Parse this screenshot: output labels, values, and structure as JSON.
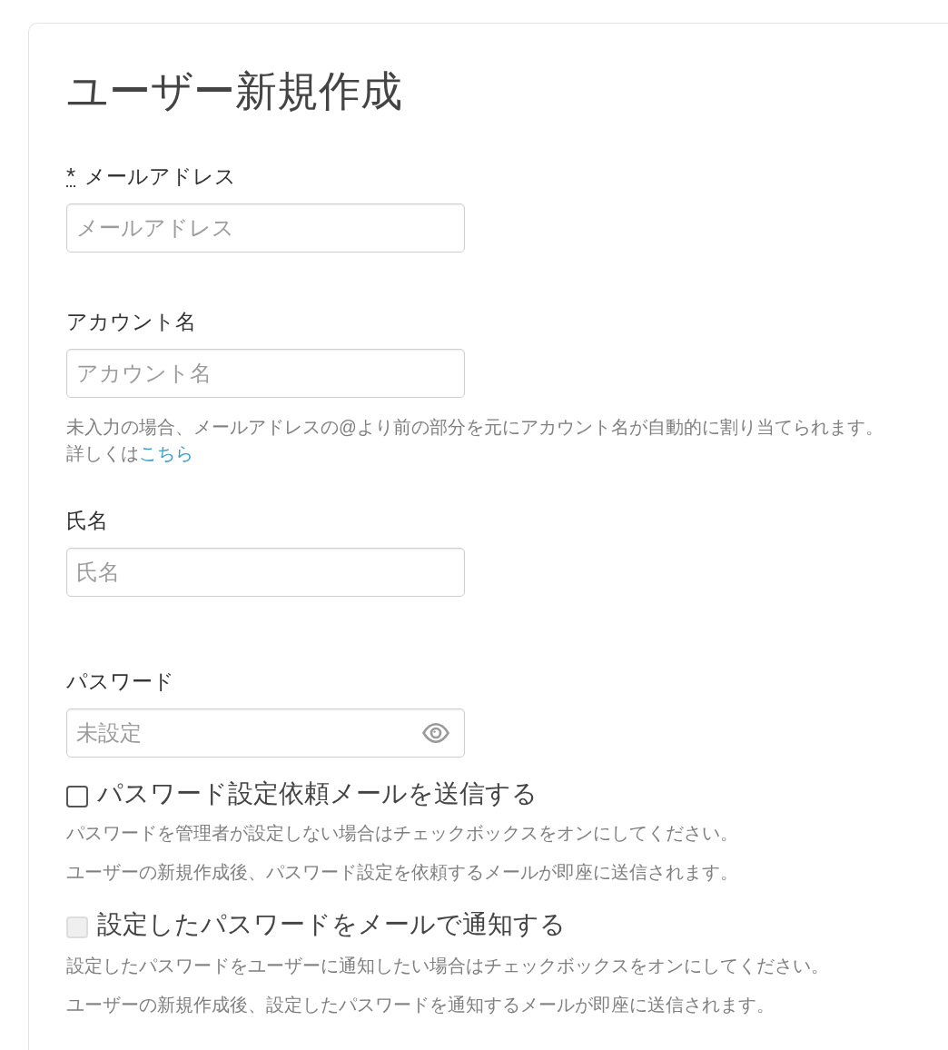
{
  "title": "ユーザー新規作成",
  "fields": [
    {
      "kind": "text",
      "label": "メールアドレス",
      "required_mark": "*",
      "placeholder": "メールアドレス"
    },
    {
      "kind": "text",
      "label": "アカウント名",
      "placeholder": "アカウント名",
      "help": {
        "text": "未入力の場合、メールアドレスの@より前の部分を元にアカウント名が自動的に割り当てられます。",
        "more": "詳しくは",
        "link": "こちら"
      }
    },
    {
      "kind": "text",
      "label": "氏名",
      "placeholder": "氏名"
    },
    {
      "kind": "password",
      "label": "パスワード",
      "placeholder": "未設定"
    }
  ],
  "options": [
    {
      "label": "パスワード設定依頼メールを送信する",
      "checked": false,
      "disabled": false,
      "notes": [
        "パスワードを管理者が設定しない場合はチェックボックスをオンにしてください。",
        "ユーザーの新規作成後、パスワード設定を依頼するメールが即座に送信されます。"
      ]
    },
    {
      "label": "設定したパスワードをメールで通知する",
      "checked": false,
      "disabled": true,
      "notes": [
        "設定したパスワードをユーザーに通知したい場合はチェックボックスをオンにしてください。",
        "ユーザーの新規作成後、設定したパスワードを通知するメールが即座に送信されます。"
      ]
    }
  ]
}
